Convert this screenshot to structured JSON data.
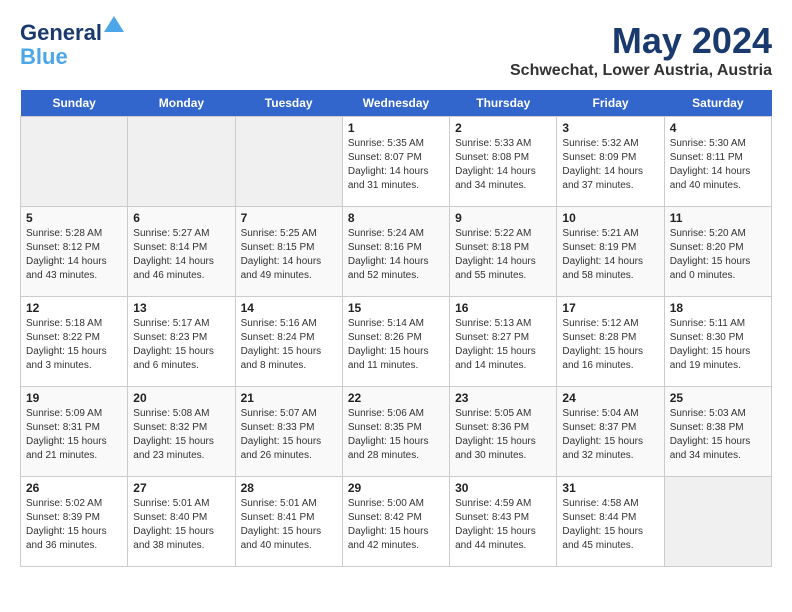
{
  "logo": {
    "line1": "General",
    "line2": "Blue"
  },
  "title": "May 2024",
  "subtitle": "Schwechat, Lower Austria, Austria",
  "days_of_week": [
    "Sunday",
    "Monday",
    "Tuesday",
    "Wednesday",
    "Thursday",
    "Friday",
    "Saturday"
  ],
  "weeks": [
    [
      {
        "day": "",
        "sunrise": "",
        "sunset": "",
        "daylight": ""
      },
      {
        "day": "",
        "sunrise": "",
        "sunset": "",
        "daylight": ""
      },
      {
        "day": "",
        "sunrise": "",
        "sunset": "",
        "daylight": ""
      },
      {
        "day": "1",
        "sunrise": "Sunrise: 5:35 AM",
        "sunset": "Sunset: 8:07 PM",
        "daylight": "Daylight: 14 hours and 31 minutes."
      },
      {
        "day": "2",
        "sunrise": "Sunrise: 5:33 AM",
        "sunset": "Sunset: 8:08 PM",
        "daylight": "Daylight: 14 hours and 34 minutes."
      },
      {
        "day": "3",
        "sunrise": "Sunrise: 5:32 AM",
        "sunset": "Sunset: 8:09 PM",
        "daylight": "Daylight: 14 hours and 37 minutes."
      },
      {
        "day": "4",
        "sunrise": "Sunrise: 5:30 AM",
        "sunset": "Sunset: 8:11 PM",
        "daylight": "Daylight: 14 hours and 40 minutes."
      }
    ],
    [
      {
        "day": "5",
        "sunrise": "Sunrise: 5:28 AM",
        "sunset": "Sunset: 8:12 PM",
        "daylight": "Daylight: 14 hours and 43 minutes."
      },
      {
        "day": "6",
        "sunrise": "Sunrise: 5:27 AM",
        "sunset": "Sunset: 8:14 PM",
        "daylight": "Daylight: 14 hours and 46 minutes."
      },
      {
        "day": "7",
        "sunrise": "Sunrise: 5:25 AM",
        "sunset": "Sunset: 8:15 PM",
        "daylight": "Daylight: 14 hours and 49 minutes."
      },
      {
        "day": "8",
        "sunrise": "Sunrise: 5:24 AM",
        "sunset": "Sunset: 8:16 PM",
        "daylight": "Daylight: 14 hours and 52 minutes."
      },
      {
        "day": "9",
        "sunrise": "Sunrise: 5:22 AM",
        "sunset": "Sunset: 8:18 PM",
        "daylight": "Daylight: 14 hours and 55 minutes."
      },
      {
        "day": "10",
        "sunrise": "Sunrise: 5:21 AM",
        "sunset": "Sunset: 8:19 PM",
        "daylight": "Daylight: 14 hours and 58 minutes."
      },
      {
        "day": "11",
        "sunrise": "Sunrise: 5:20 AM",
        "sunset": "Sunset: 8:20 PM",
        "daylight": "Daylight: 15 hours and 0 minutes."
      }
    ],
    [
      {
        "day": "12",
        "sunrise": "Sunrise: 5:18 AM",
        "sunset": "Sunset: 8:22 PM",
        "daylight": "Daylight: 15 hours and 3 minutes."
      },
      {
        "day": "13",
        "sunrise": "Sunrise: 5:17 AM",
        "sunset": "Sunset: 8:23 PM",
        "daylight": "Daylight: 15 hours and 6 minutes."
      },
      {
        "day": "14",
        "sunrise": "Sunrise: 5:16 AM",
        "sunset": "Sunset: 8:24 PM",
        "daylight": "Daylight: 15 hours and 8 minutes."
      },
      {
        "day": "15",
        "sunrise": "Sunrise: 5:14 AM",
        "sunset": "Sunset: 8:26 PM",
        "daylight": "Daylight: 15 hours and 11 minutes."
      },
      {
        "day": "16",
        "sunrise": "Sunrise: 5:13 AM",
        "sunset": "Sunset: 8:27 PM",
        "daylight": "Daylight: 15 hours and 14 minutes."
      },
      {
        "day": "17",
        "sunrise": "Sunrise: 5:12 AM",
        "sunset": "Sunset: 8:28 PM",
        "daylight": "Daylight: 15 hours and 16 minutes."
      },
      {
        "day": "18",
        "sunrise": "Sunrise: 5:11 AM",
        "sunset": "Sunset: 8:30 PM",
        "daylight": "Daylight: 15 hours and 19 minutes."
      }
    ],
    [
      {
        "day": "19",
        "sunrise": "Sunrise: 5:09 AM",
        "sunset": "Sunset: 8:31 PM",
        "daylight": "Daylight: 15 hours and 21 minutes."
      },
      {
        "day": "20",
        "sunrise": "Sunrise: 5:08 AM",
        "sunset": "Sunset: 8:32 PM",
        "daylight": "Daylight: 15 hours and 23 minutes."
      },
      {
        "day": "21",
        "sunrise": "Sunrise: 5:07 AM",
        "sunset": "Sunset: 8:33 PM",
        "daylight": "Daylight: 15 hours and 26 minutes."
      },
      {
        "day": "22",
        "sunrise": "Sunrise: 5:06 AM",
        "sunset": "Sunset: 8:35 PM",
        "daylight": "Daylight: 15 hours and 28 minutes."
      },
      {
        "day": "23",
        "sunrise": "Sunrise: 5:05 AM",
        "sunset": "Sunset: 8:36 PM",
        "daylight": "Daylight: 15 hours and 30 minutes."
      },
      {
        "day": "24",
        "sunrise": "Sunrise: 5:04 AM",
        "sunset": "Sunset: 8:37 PM",
        "daylight": "Daylight: 15 hours and 32 minutes."
      },
      {
        "day": "25",
        "sunrise": "Sunrise: 5:03 AM",
        "sunset": "Sunset: 8:38 PM",
        "daylight": "Daylight: 15 hours and 34 minutes."
      }
    ],
    [
      {
        "day": "26",
        "sunrise": "Sunrise: 5:02 AM",
        "sunset": "Sunset: 8:39 PM",
        "daylight": "Daylight: 15 hours and 36 minutes."
      },
      {
        "day": "27",
        "sunrise": "Sunrise: 5:01 AM",
        "sunset": "Sunset: 8:40 PM",
        "daylight": "Daylight: 15 hours and 38 minutes."
      },
      {
        "day": "28",
        "sunrise": "Sunrise: 5:01 AM",
        "sunset": "Sunset: 8:41 PM",
        "daylight": "Daylight: 15 hours and 40 minutes."
      },
      {
        "day": "29",
        "sunrise": "Sunrise: 5:00 AM",
        "sunset": "Sunset: 8:42 PM",
        "daylight": "Daylight: 15 hours and 42 minutes."
      },
      {
        "day": "30",
        "sunrise": "Sunrise: 4:59 AM",
        "sunset": "Sunset: 8:43 PM",
        "daylight": "Daylight: 15 hours and 44 minutes."
      },
      {
        "day": "31",
        "sunrise": "Sunrise: 4:58 AM",
        "sunset": "Sunset: 8:44 PM",
        "daylight": "Daylight: 15 hours and 45 minutes."
      },
      {
        "day": "",
        "sunrise": "",
        "sunset": "",
        "daylight": ""
      }
    ]
  ]
}
